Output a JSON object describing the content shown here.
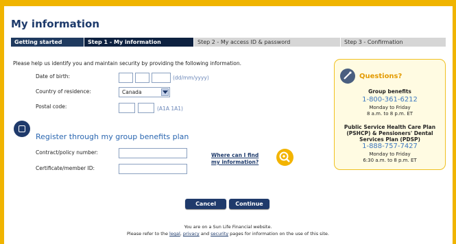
{
  "page": {
    "title": "My information",
    "intro": "Please help us identify you and maintain security by providing the following information."
  },
  "steps": [
    {
      "label": "Getting started",
      "state": "done"
    },
    {
      "label": "Step 1 - My information",
      "state": "active"
    },
    {
      "label": "Step 2 - My access ID & password",
      "state": "todo"
    },
    {
      "label": "Step 3 - Confirmation",
      "state": "todo"
    }
  ],
  "form": {
    "dob": {
      "label": "Date of birth:",
      "hint": "(dd/mm/yyyy)",
      "day": "",
      "month": "",
      "year": ""
    },
    "country": {
      "label": "Country of residence:",
      "value": "Canada"
    },
    "postal": {
      "label": "Postal code:",
      "hint": "(A1A 1A1)",
      "part1": "",
      "part2": ""
    }
  },
  "register": {
    "title": "Register through my group benefits plan",
    "contract_label": "Contract/policy number:",
    "certificate_label": "Certificate/member ID:",
    "help_link_line1": "Where can I find",
    "help_link_line2": "my information?"
  },
  "questions": {
    "title": "Questions?",
    "group_title": "Group benefits",
    "group_phone": "1-800-361-6212",
    "group_days": "Monday to Friday",
    "group_hours": "8 a.m. to 8 p.m. ET",
    "pshcp_title_1": "Public Service Health Care Plan",
    "pshcp_title_2": "(PSHCP) & Pensioners' Dental",
    "pshcp_title_3": "Services Plan (PDSP)",
    "pshcp_phone": "1-888-757-7427",
    "pshcp_days": "Monday to Friday",
    "pshcp_hours": "6:30 a.m. to 8 p.m. ET"
  },
  "buttons": {
    "cancel": "Cancel",
    "continue": "Continue"
  },
  "footer": {
    "line1": "You are on a Sun Life Financial website.",
    "line2_pre": "Please refer to the ",
    "legal": "legal",
    "sep1": ", ",
    "privacy": "privacy",
    "sep2": " and ",
    "security": "security",
    "line2_post": " pages for information on the use of this site."
  },
  "colors": {
    "frame": "#f0b400",
    "navy": "#1f3a6b",
    "link_blue": "#2a66b0",
    "accent_orange": "#e39a00"
  },
  "icons": {
    "register": "add-plan-icon",
    "help": "magnifier-icon",
    "questions": "question-icon"
  }
}
